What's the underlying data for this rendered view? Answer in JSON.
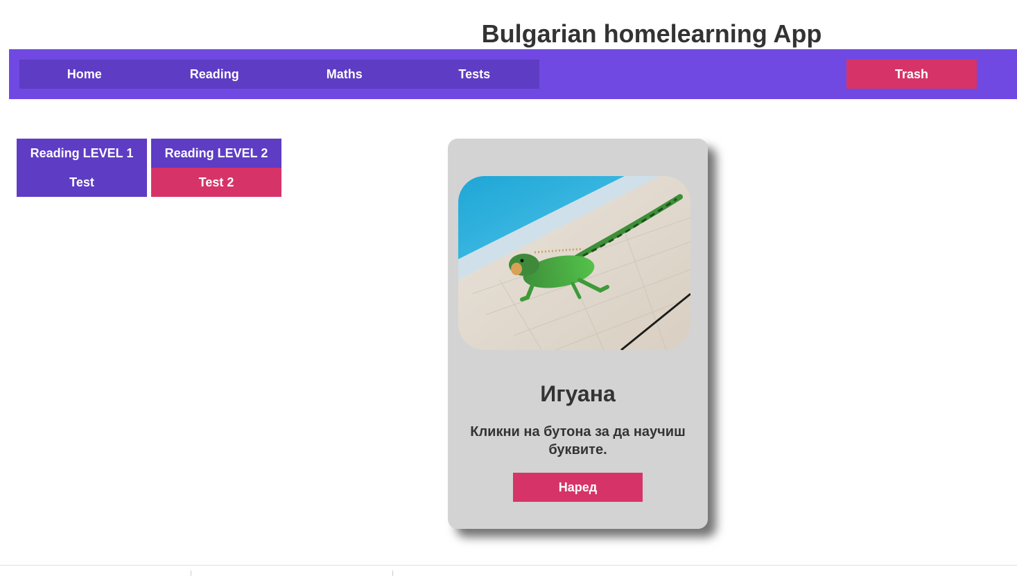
{
  "app": {
    "title": "Bulgarian homelearning App"
  },
  "nav": {
    "items": [
      {
        "label": "Home"
      },
      {
        "label": "Reading"
      },
      {
        "label": "Maths"
      },
      {
        "label": "Tests"
      }
    ],
    "trash_label": "Trash"
  },
  "levels": [
    {
      "label": "Reading LEVEL 1",
      "test_label": "Test"
    },
    {
      "label": "Reading LEVEL 2",
      "test_label": "Test 2"
    }
  ],
  "card": {
    "image_icon": "iguana-photo",
    "title": "Игуана",
    "text": "Кликни на бутона за да научиш буквите.",
    "button_label": "Наред"
  },
  "colors": {
    "navbar": "#7049e3",
    "nav_group": "#5e3cc4",
    "accent_pink": "#d63468",
    "card_bg": "#d3d3d3"
  }
}
